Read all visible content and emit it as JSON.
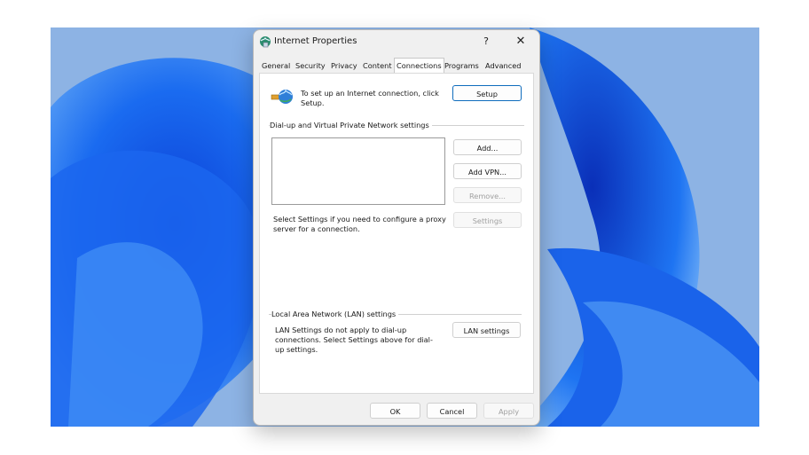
{
  "dialog": {
    "title": "Internet Properties",
    "help_label": "?",
    "close_label": "✕"
  },
  "tabs": [
    {
      "label": "General"
    },
    {
      "label": "Security"
    },
    {
      "label": "Privacy"
    },
    {
      "label": "Content"
    },
    {
      "label": "Connections"
    },
    {
      "label": "Programs"
    },
    {
      "label": "Advanced"
    }
  ],
  "active_tab": "Connections",
  "setup": {
    "text": "To set up an Internet connection, click Setup.",
    "button": "Setup"
  },
  "dialup": {
    "group_label": "Dial-up and Virtual Private Network settings",
    "add_button": "Add...",
    "add_vpn_button": "Add VPN...",
    "remove_button": "Remove...",
    "settings_button": "Settings",
    "proxy_text": "Select Settings if you need to configure a proxy server for a connection."
  },
  "lan": {
    "group_label": "Local Area Network (LAN) settings",
    "text": "LAN Settings do not apply to dial-up connections. Select Settings above for dial-up settings.",
    "button": "LAN settings"
  },
  "footer": {
    "ok": "OK",
    "cancel": "Cancel",
    "apply": "Apply"
  },
  "colors": {
    "accent": "#0f6cbd",
    "wallpaper_blue": "#1560e8"
  }
}
